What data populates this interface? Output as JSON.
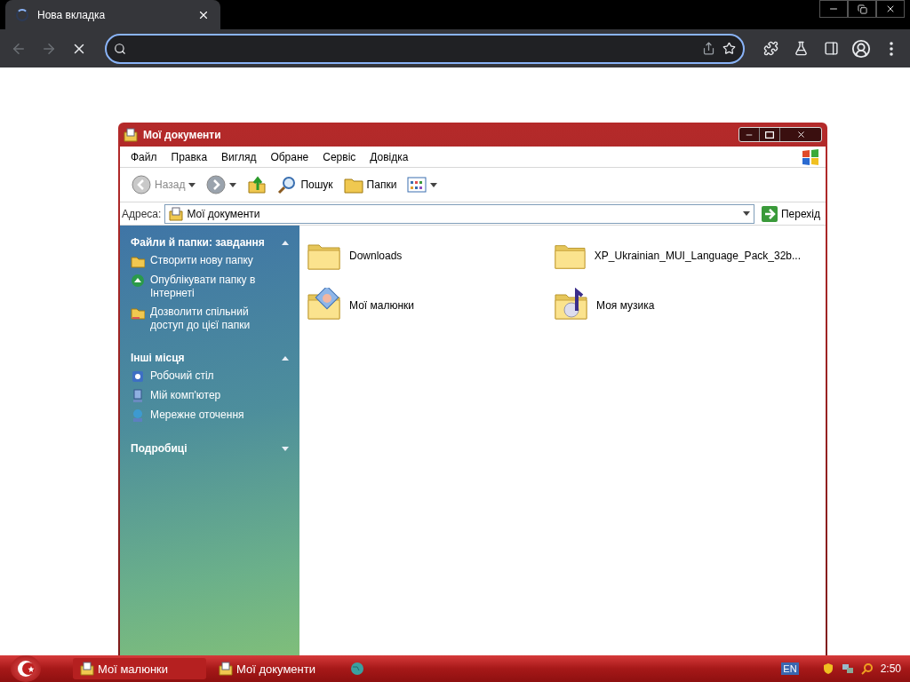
{
  "browser": {
    "tab": {
      "title": "Нова вкладка",
      "loading": true
    }
  },
  "window": {
    "title": "Мої документи",
    "menu": [
      "Файл",
      "Правка",
      "Вигляд",
      "Обране",
      "Сервіс",
      "Довідка"
    ],
    "toolbar": [
      {
        "kind": "back",
        "label": "Назад",
        "disabled": true
      },
      {
        "kind": "forward",
        "disabled": false
      },
      {
        "kind": "up"
      },
      {
        "kind": "search",
        "label": "Пошук"
      },
      {
        "kind": "folders",
        "label": "Папки"
      },
      {
        "kind": "views"
      }
    ],
    "address": {
      "label": "Адреса:",
      "value": "Мої документи",
      "go": "Перехід"
    },
    "task_panes": [
      {
        "title": "Файли й папки: завдання",
        "expanded": true,
        "items": [
          {
            "kind": "newfolder",
            "label": "Створити нову папку"
          },
          {
            "kind": "publish",
            "label": "Опублікувати папку в Інтернеті"
          },
          {
            "kind": "share",
            "label": "Дозволити спільний доступ до цієї папки"
          }
        ]
      },
      {
        "title": "Інші місця",
        "expanded": true,
        "items": [
          {
            "kind": "desktop",
            "label": "Робочий стіл"
          },
          {
            "kind": "computer",
            "label": "Мій комп'ютер"
          },
          {
            "kind": "network",
            "label": "Мережне оточення"
          }
        ]
      },
      {
        "title": "Подробиці",
        "expanded": false
      }
    ],
    "files": [
      {
        "kind": "folder",
        "name": "Downloads"
      },
      {
        "kind": "folder",
        "name": "XP_Ukrainian_MUI_Language_Pack_32b..."
      },
      {
        "kind": "pictures",
        "name": "Мої малюнки"
      },
      {
        "kind": "music",
        "name": "Моя музика"
      }
    ]
  },
  "taskbar": {
    "tasks": [
      {
        "label": "Мої малюнки",
        "selected": true
      },
      {
        "label": "Мої документи",
        "selected": false
      }
    ],
    "language": "EN",
    "clock": "2:50"
  }
}
